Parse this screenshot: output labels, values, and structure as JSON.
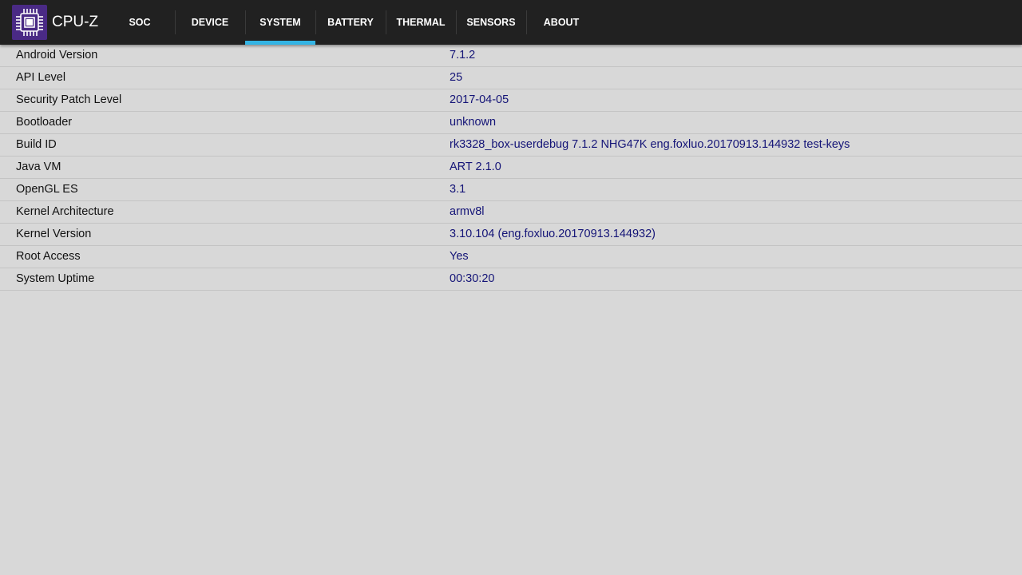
{
  "app": {
    "title": "CPU-Z",
    "logo_icon": "cpu-chip-icon"
  },
  "colors": {
    "appbar": "#212121",
    "accent": "#34b4e4",
    "logo_bg": "#4a2a85",
    "background": "#d8d8d8",
    "value_text": "#141477"
  },
  "tabs": [
    {
      "label": "SOC",
      "active": false
    },
    {
      "label": "DEVICE",
      "active": false
    },
    {
      "label": "SYSTEM",
      "active": true
    },
    {
      "label": "BATTERY",
      "active": false
    },
    {
      "label": "THERMAL",
      "active": false
    },
    {
      "label": "SENSORS",
      "active": false
    },
    {
      "label": "ABOUT",
      "active": false
    }
  ],
  "rows": [
    {
      "key": "Android Version",
      "value": "7.1.2"
    },
    {
      "key": "API Level",
      "value": "25"
    },
    {
      "key": "Security Patch Level",
      "value": "2017-04-05"
    },
    {
      "key": "Bootloader",
      "value": "unknown"
    },
    {
      "key": "Build ID",
      "value": "rk3328_box-userdebug 7.1.2 NHG47K eng.foxluo.20170913.144932 test-keys"
    },
    {
      "key": "Java VM",
      "value": "ART 2.1.0"
    },
    {
      "key": "OpenGL ES",
      "value": "3.1"
    },
    {
      "key": "Kernel Architecture",
      "value": "armv8l"
    },
    {
      "key": "Kernel Version",
      "value": "3.10.104 (eng.foxluo.20170913.144932)"
    },
    {
      "key": "Root Access",
      "value": "Yes"
    },
    {
      "key": "System Uptime",
      "value": "00:30:20"
    }
  ]
}
